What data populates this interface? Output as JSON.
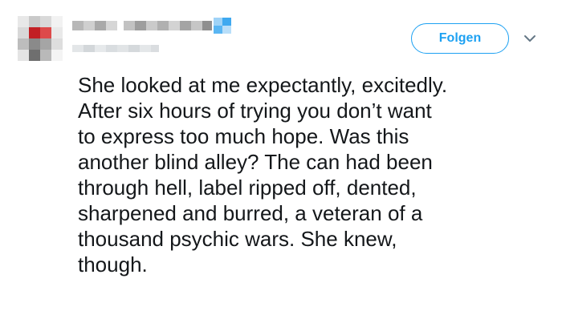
{
  "tweet": {
    "follow_label": "Folgen",
    "text_lines": [
      "She looked at me expectantly, excitedly.",
      "After six hours of trying you don’t want",
      "to express too much hope. Was this",
      "another blind alley? The can had been",
      "through hell, label ripped off, dented,",
      "sharpened and burred, a veteran of a",
      "thousand psychic wars. She knew,",
      "though."
    ]
  },
  "icons": {
    "verified": "verified-badge-icon",
    "chevron": "chevron-down-icon"
  },
  "colors": {
    "accent": "#1da1f2",
    "text": "#14171a"
  }
}
